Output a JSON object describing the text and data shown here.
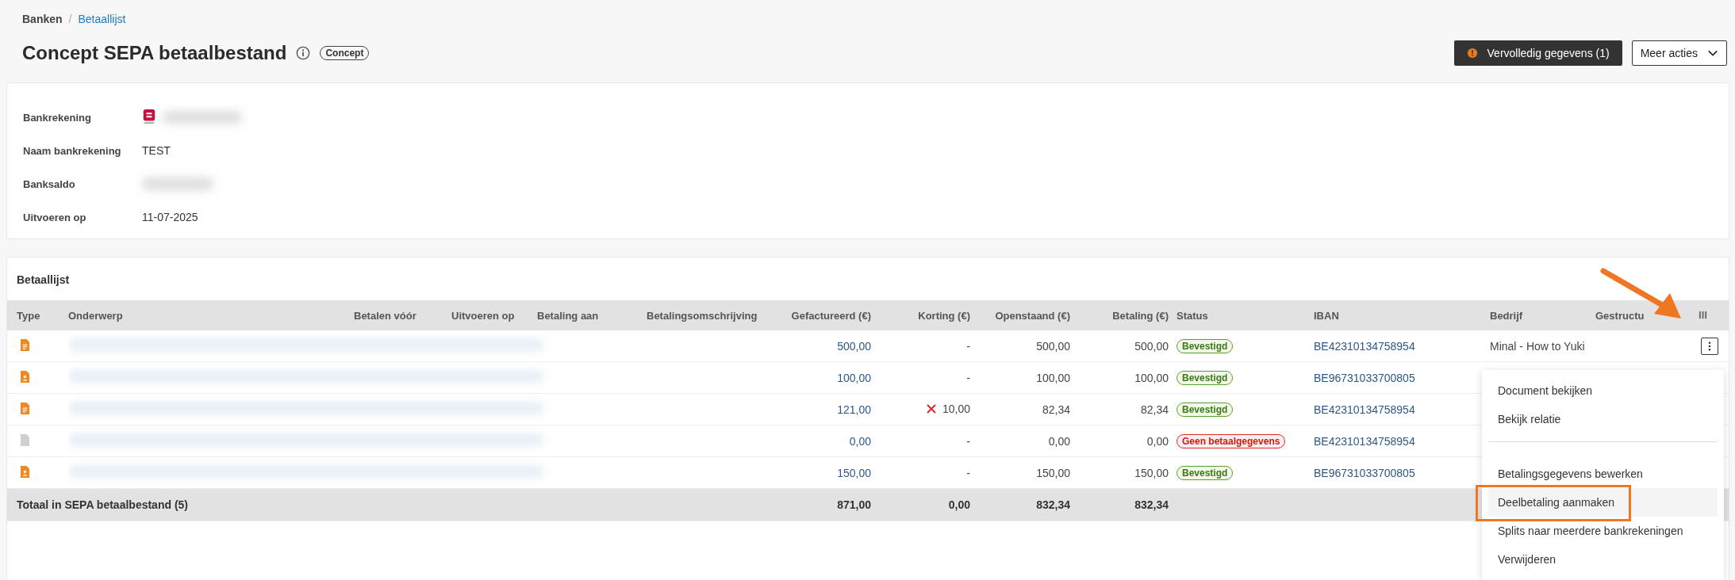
{
  "breadcrumb_separator": "/",
  "breadcrumb": [
    {
      "label": "Banken",
      "current": false
    },
    {
      "label": "Betaallijst",
      "current": true
    }
  ],
  "title": "Concept SEPA betaalbestand",
  "badge": "Concept",
  "actions": {
    "primary": "Vervolledig gegevens (1)",
    "secondary": "Meer acties"
  },
  "details": [
    {
      "label": "Bankrekening",
      "kind": "bank"
    },
    {
      "label": "Naam bankrekening",
      "kind": "text",
      "value": "TEST"
    },
    {
      "label": "Banksaldo",
      "kind": "hidden"
    },
    {
      "label": "Uitvoeren op",
      "kind": "text",
      "value": "11-07-2025"
    }
  ],
  "section_title": "Betaallijst",
  "table": {
    "columns": [
      "Type",
      "Onderwerp",
      "Betalen vóór",
      "Uitvoeren op",
      "Betaling aan",
      "Betalingsomschrijving",
      "Gefactureerd (€)",
      "Korting (€)",
      "Openstaand (€)",
      "Betaling (€)",
      "Status",
      "IBAN",
      "Bedrijf",
      "Gestructu"
    ],
    "rows": [
      {
        "kind": "document",
        "invoiced": "500,00",
        "discount": "-",
        "discount_rejected": false,
        "open": "500,00",
        "payment": "500,00",
        "status": {
          "label": "Bevestigd",
          "kind": "ok"
        },
        "iban": "BE42310134758954",
        "company": "Minal - How to Yuki",
        "menu_open": true
      },
      {
        "kind": "contact",
        "invoiced": "100,00",
        "discount": "-",
        "discount_rejected": false,
        "open": "100,00",
        "payment": "100,00",
        "status": {
          "label": "Bevestigd",
          "kind": "ok"
        },
        "iban": "BE96731033700805",
        "menu_open": false
      },
      {
        "kind": "document",
        "invoiced": "121,00",
        "discount": "10,00",
        "discount_rejected": true,
        "open": "82,34",
        "payment": "82,34",
        "status": {
          "label": "Bevestigd",
          "kind": "ok"
        },
        "iban": "BE42310134758954",
        "menu_open": false
      },
      {
        "kind": "empty",
        "invoiced": "0,00",
        "discount": "-",
        "discount_rejected": false,
        "open": "0,00",
        "payment": "0,00",
        "status": {
          "label": "Geen betaalgegevens",
          "kind": "error"
        },
        "iban": "BE42310134758954",
        "menu_open": false
      },
      {
        "kind": "contact",
        "invoiced": "150,00",
        "discount": "-",
        "discount_rejected": false,
        "open": "150,00",
        "payment": "150,00",
        "status": {
          "label": "Bevestigd",
          "kind": "ok"
        },
        "iban": "BE96731033700805",
        "menu_open": false
      }
    ],
    "total": {
      "label": "Totaal in SEPA betaalbestand (5)",
      "invoiced": "871,00",
      "discount": "0,00",
      "open": "832,34",
      "payment": "832,34"
    }
  },
  "menu": [
    [
      {
        "label": "Document bekijken",
        "selected": false
      },
      {
        "label": "Bekijk relatie",
        "selected": false
      }
    ],
    [
      {
        "label": "Betalingsgegevens bewerken",
        "selected": false
      },
      {
        "label": "Deelbetaling aanmaken",
        "selected": true
      },
      {
        "label": "Splits naar meerdere bankrekeningen",
        "selected": false
      },
      {
        "label": "Verwijderen",
        "selected": false
      }
    ]
  ]
}
